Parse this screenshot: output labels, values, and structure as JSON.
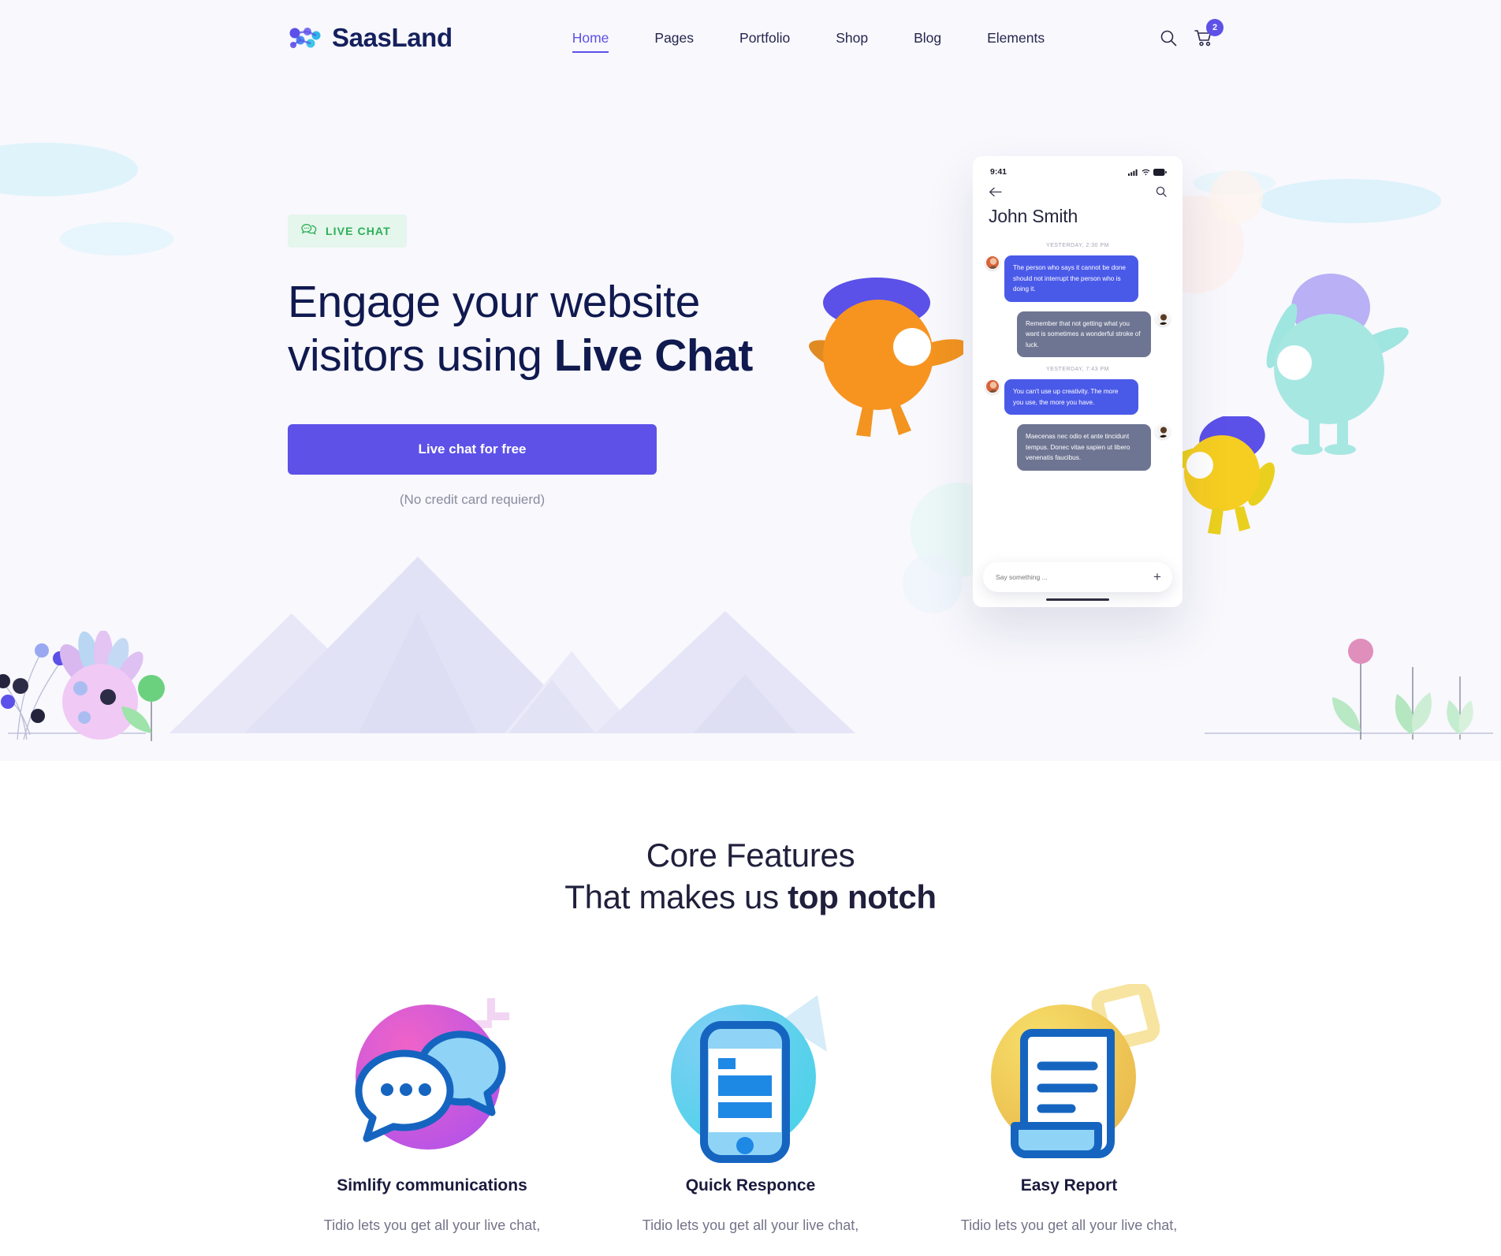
{
  "brand": {
    "name": "SaasLand",
    "logo_icon": "saasland-dots-logo"
  },
  "nav": {
    "links": [
      {
        "label": "Home",
        "active": true
      },
      {
        "label": "Pages",
        "active": false
      },
      {
        "label": "Portfolio",
        "active": false
      },
      {
        "label": "Shop",
        "active": false
      },
      {
        "label": "Blog",
        "active": false
      },
      {
        "label": "Elements",
        "active": false
      }
    ],
    "search_icon": "search-icon",
    "cart_icon": "cart-icon",
    "cart_count": "2"
  },
  "hero": {
    "badge": {
      "text": "LIVE CHAT",
      "icon": "chat-bubble-icon",
      "color": "#2cb057",
      "bg": "#e5f6ec"
    },
    "title_line1": "Engage your website",
    "title_line2_normal": "visitors using ",
    "title_line2_bold": "Live Chat",
    "cta_label": "Live chat for free",
    "cta_color": "#5d51e8",
    "note": "(No credit card requierd)"
  },
  "phone": {
    "status_time": "9:41",
    "contact_name": "John Smith",
    "back_icon": "arrow-left-icon",
    "search_icon": "search-icon",
    "threads": [
      {
        "timestamp": "YESTERDAY, 2:30 PM",
        "messages": [
          {
            "dir": "in",
            "text": "The person who says it cannot be done should not interrupt the person who is doing it."
          },
          {
            "dir": "out",
            "text": "Remember that not getting what you want is sometimes a wonderful stroke of luck."
          }
        ]
      },
      {
        "timestamp": "YESTERDAY, 7:43 PM",
        "messages": [
          {
            "dir": "in",
            "text": "You can't use up creativity. The more you use, the more you have."
          },
          {
            "dir": "out",
            "text": "Maecenas nec odio et ante tincidunt tempus. Donec vitae sapien ut libero venenatis faucibus."
          }
        ]
      }
    ],
    "input_placeholder": "Say something ...",
    "plus_icon": "plus-icon"
  },
  "features": {
    "title_line1": "Core Features",
    "title_line2_normal": "That makes us ",
    "title_line2_bold": "top notch",
    "cards": [
      {
        "icon": "chat-bubbles-icon",
        "title": "Simlify communications",
        "desc": "Tidio lets you get all your live chat,"
      },
      {
        "icon": "mobile-phone-icon",
        "title": "Quick Responce",
        "desc": "Tidio lets you get all your live chat,"
      },
      {
        "icon": "document-report-icon",
        "title": "Easy Report",
        "desc": "Tidio lets you get all your live chat,"
      }
    ]
  }
}
